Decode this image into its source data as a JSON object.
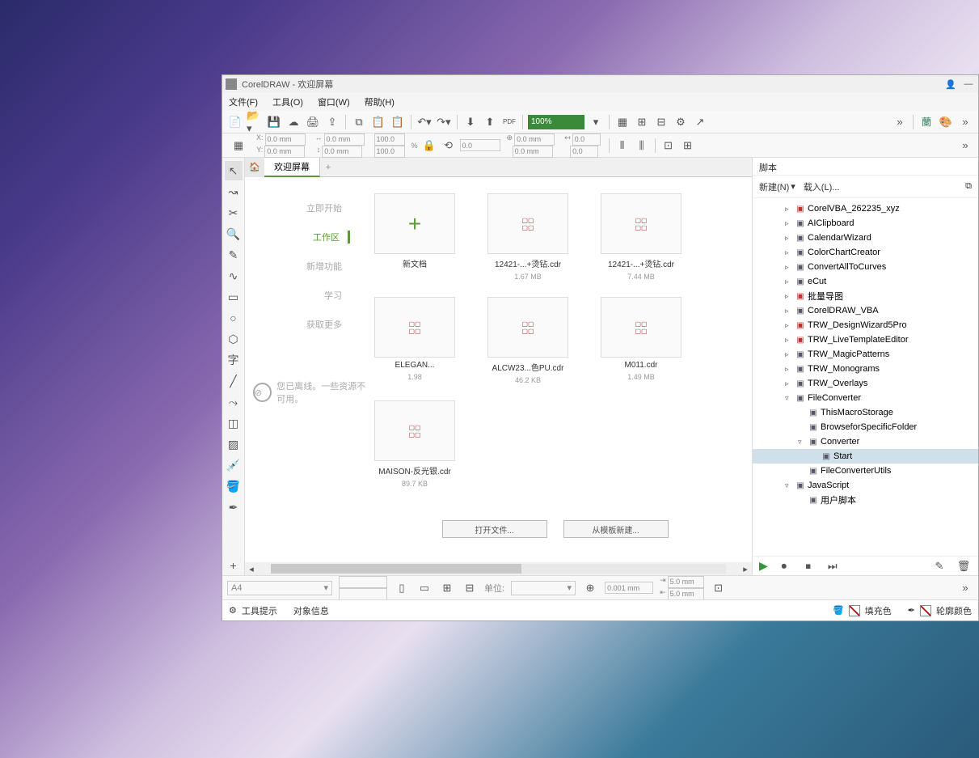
{
  "title": "CorelDRAW - 欢迎屏幕",
  "menu": {
    "file": "文件(F)",
    "tools": "工具(O)",
    "window": "窗口(W)",
    "help": "帮助(H)"
  },
  "zoom": "100%",
  "props": {
    "x": "0.0 mm",
    "y": "0.0 mm",
    "w": "0.0 mm",
    "h": "0.0 mm",
    "sx": "100.0",
    "sy": "100.0",
    "rot": "0.0",
    "ox": "0.0 mm",
    "oy": "0.0 mm",
    "px": "0.0",
    "py": "0.0"
  },
  "tab": "欢迎屏幕",
  "nav": {
    "start": "立即开始",
    "workspace": "工作区",
    "whatsnew": "新增功能",
    "learn": "学习",
    "getmore": "获取更多"
  },
  "newdoc": "新文档",
  "recent": [
    {
      "name": "12421-...+烫钻.cdr",
      "size": "1.67 MB"
    },
    {
      "name": "12421-...+烫钻.cdr",
      "size": "7.44 MB"
    },
    {
      "name": "ELEGAN...",
      "size": "1.98"
    },
    {
      "name": "ALCW23...色PU.cdr",
      "size": "46.2 KB"
    },
    {
      "name": "M011.cdr",
      "size": "1.49 MB"
    },
    {
      "name": "MAISON-反光银.cdr",
      "size": "89.7 KB"
    }
  ],
  "offline": "您已离线。一些资源不可用。",
  "btn_open": "打开文件...",
  "btn_template": "从模板新建...",
  "scripts_title": "脚本",
  "scripts_new": "新建(N)",
  "scripts_load": "载入(L)...",
  "tree": [
    {
      "lvl": 0,
      "exp": "▹",
      "ico": "red",
      "txt": "CorelVBA_262235_xyz"
    },
    {
      "lvl": 0,
      "exp": "▹",
      "ico": "mod",
      "txt": "AIClipboard"
    },
    {
      "lvl": 0,
      "exp": "▹",
      "ico": "mod",
      "txt": "CalendarWizard"
    },
    {
      "lvl": 0,
      "exp": "▹",
      "ico": "mod",
      "txt": "ColorChartCreator"
    },
    {
      "lvl": 0,
      "exp": "▹",
      "ico": "mod",
      "txt": "ConvertAllToCurves"
    },
    {
      "lvl": 0,
      "exp": "▹",
      "ico": "mod",
      "txt": "eCut"
    },
    {
      "lvl": 0,
      "exp": "▹",
      "ico": "red",
      "txt": "批量导图"
    },
    {
      "lvl": 0,
      "exp": "▹",
      "ico": "mod",
      "txt": "CorelDRAW_VBA"
    },
    {
      "lvl": 0,
      "exp": "▹",
      "ico": "red",
      "txt": "TRW_DesignWizard5Pro"
    },
    {
      "lvl": 0,
      "exp": "▹",
      "ico": "red",
      "txt": "TRW_LiveTemplateEditor"
    },
    {
      "lvl": 0,
      "exp": "▹",
      "ico": "mod",
      "txt": "TRW_MagicPatterns"
    },
    {
      "lvl": 0,
      "exp": "▹",
      "ico": "mod",
      "txt": "TRW_Monograms"
    },
    {
      "lvl": 0,
      "exp": "▹",
      "ico": "mod",
      "txt": "TRW_Overlays"
    },
    {
      "lvl": 0,
      "exp": "▿",
      "ico": "mod",
      "txt": "FileConverter"
    },
    {
      "lvl": 1,
      "exp": "",
      "ico": "mod",
      "txt": "ThisMacroStorage"
    },
    {
      "lvl": 1,
      "exp": "",
      "ico": "mod",
      "txt": "BrowseforSpecificFolder"
    },
    {
      "lvl": 1,
      "exp": "▿",
      "ico": "mod",
      "txt": "Converter"
    },
    {
      "lvl": 2,
      "exp": "",
      "ico": "mod",
      "txt": "Start",
      "sel": true
    },
    {
      "lvl": 1,
      "exp": "",
      "ico": "mod",
      "txt": "FileConverterUtils"
    },
    {
      "lvl": 0,
      "exp": "▿",
      "ico": "mod",
      "txt": "JavaScript"
    },
    {
      "lvl": 1,
      "exp": "",
      "ico": "mod",
      "txt": "用户脚本"
    }
  ],
  "paper": "A4",
  "units": "单位:",
  "nudge": "0.001 mm",
  "dup_x": "5.0 mm",
  "dup_y": "5.0 mm",
  "status": {
    "tooltips": "工具提示",
    "objinfo": "对象信息",
    "fill": "填充色",
    "outline": "轮廓颜色"
  }
}
